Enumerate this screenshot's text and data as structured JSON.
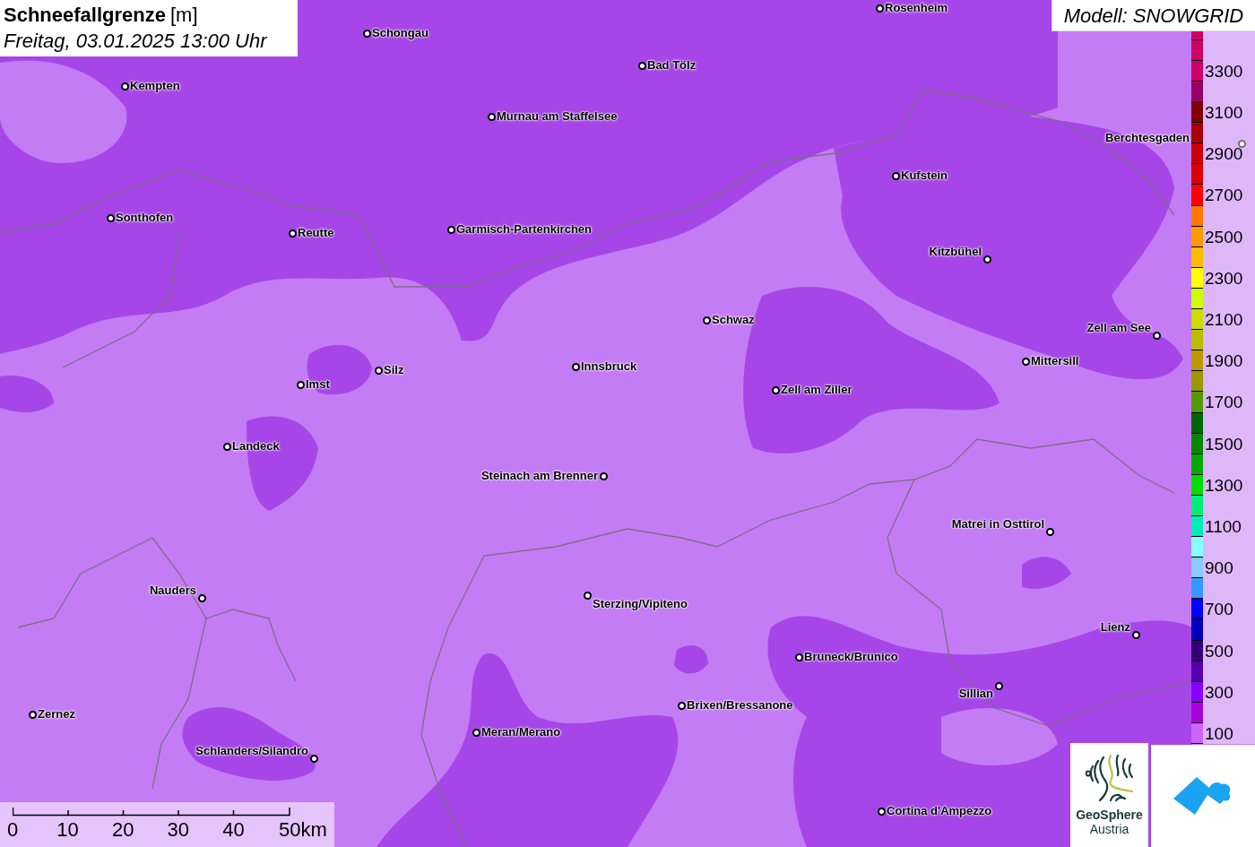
{
  "title": {
    "heading": "Schneefallgrenze",
    "unit": "[m]",
    "date": "Freitag, 03.01.2025 13:00 Uhr"
  },
  "model": "Modell: SNOWGRID",
  "cities": [
    {
      "name": "Rosenheim"
    },
    {
      "name": "Schongau"
    },
    {
      "name": "Bad Tölz"
    },
    {
      "name": "Kempten"
    },
    {
      "name": "Murnau am Staffelsee"
    },
    {
      "name": "Berchtesgaden"
    },
    {
      "name": "Kufstein"
    },
    {
      "name": "Sonthofen"
    },
    {
      "name": "Reutte"
    },
    {
      "name": "Garmisch-Partenkirchen"
    },
    {
      "name": "Kitzbühel"
    },
    {
      "name": "Schwaz"
    },
    {
      "name": "Zell am See"
    },
    {
      "name": "Mittersill"
    },
    {
      "name": "Silz"
    },
    {
      "name": "Innsbruck"
    },
    {
      "name": "Imst"
    },
    {
      "name": "Zell am Ziller"
    },
    {
      "name": "Landeck"
    },
    {
      "name": "Steinach am Brenner"
    },
    {
      "name": "Matrei in Osttirol"
    },
    {
      "name": "Nauders"
    },
    {
      "name": "Sterzing/Vipiteno"
    },
    {
      "name": "Lienz"
    },
    {
      "name": "Bruneck/Brunico"
    },
    {
      "name": "Sillian"
    },
    {
      "name": "Brixen/Bressanone"
    },
    {
      "name": "Zernez"
    },
    {
      "name": "Meran/Merano"
    },
    {
      "name": "Schlanders/Silandro"
    },
    {
      "name": "Cortina d'Ampezzo"
    }
  ],
  "legend": {
    "bins": [
      {
        "color": "#cc0066"
      },
      {
        "color": "#cc0066"
      },
      {
        "color": "#cc0066",
        "label": "3300"
      },
      {
        "color": "#990066"
      },
      {
        "color": "#800000",
        "label": "3100"
      },
      {
        "color": "#aa0000"
      },
      {
        "color": "#cc0000",
        "label": "2900"
      },
      {
        "color": "#dd0000"
      },
      {
        "color": "#ff0000",
        "label": "2700"
      },
      {
        "color": "#ff7700"
      },
      {
        "color": "#ff9900",
        "label": "2500"
      },
      {
        "color": "#ffbb00"
      },
      {
        "color": "#ffff00",
        "label": "2300"
      },
      {
        "color": "#ccff00"
      },
      {
        "color": "#ccdd00",
        "label": "2100"
      },
      {
        "color": "#bbbb00"
      },
      {
        "color": "#bb9900",
        "label": "1900"
      },
      {
        "color": "#999900"
      },
      {
        "color": "#559900",
        "label": "1700"
      },
      {
        "color": "#006600"
      },
      {
        "color": "#008800",
        "label": "1500"
      },
      {
        "color": "#00aa00"
      },
      {
        "color": "#00dd00",
        "label": "1300"
      },
      {
        "color": "#00ee77"
      },
      {
        "color": "#00eebb",
        "label": "1100"
      },
      {
        "color": "#88ffff"
      },
      {
        "color": "#88ccff",
        "label": "900"
      },
      {
        "color": "#3399ff"
      },
      {
        "color": "#0000ff",
        "label": "700"
      },
      {
        "color": "#0000bb"
      },
      {
        "color": "#330077",
        "label": "500"
      },
      {
        "color": "#5500aa"
      },
      {
        "color": "#8800ff",
        "label": "300"
      },
      {
        "color": "#aa00dd"
      },
      {
        "color": "#cc66ff",
        "label": "100"
      }
    ]
  },
  "scale_bar": [
    "0",
    "10",
    "20",
    "30",
    "40",
    "50km"
  ],
  "logo": {
    "name": "GeoSphere",
    "country": "Austria"
  }
}
